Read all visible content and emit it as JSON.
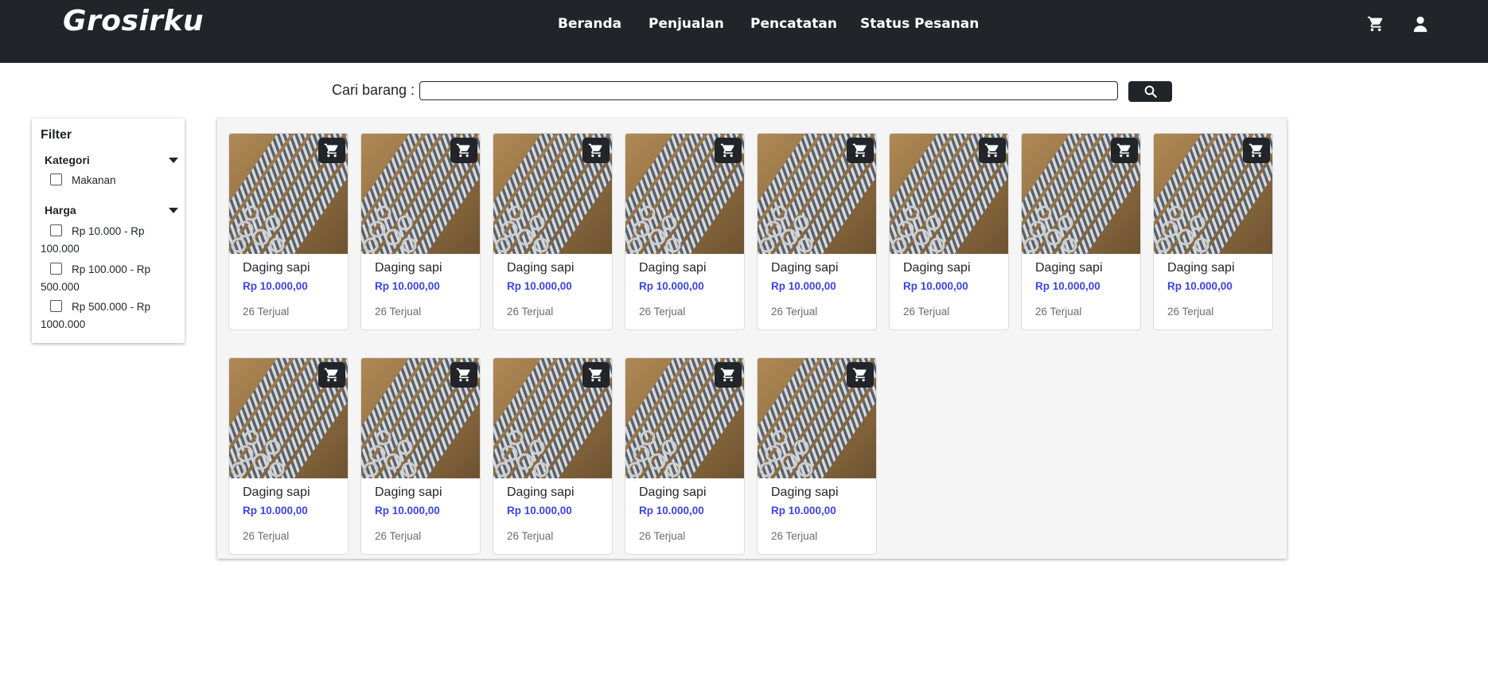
{
  "navbar": {
    "logo": "Grosirku",
    "links": [
      {
        "label": "Beranda"
      },
      {
        "label": "Penjualan"
      },
      {
        "label": "Pencatatan"
      },
      {
        "label": "Status Pesanan"
      }
    ],
    "icons": [
      "cart-icon",
      "user-icon"
    ]
  },
  "search": {
    "label": "Cari barang :",
    "value": "",
    "placeholder": "",
    "button_icon": "search-icon"
  },
  "filter": {
    "title": "Filter",
    "groups": [
      {
        "label": "Kategori",
        "options": [
          "Makanan"
        ]
      },
      {
        "label": "Harga",
        "options": [
          "Rp 10.000 - Rp 100.000",
          "Rp 100.000 - Rp 500.000",
          "Rp 500.000 - Rp 1000.000"
        ]
      }
    ]
  },
  "products": [
    {
      "name": "Daging sapi",
      "price": "Rp 10.000,00",
      "sold": "26 Terjual"
    },
    {
      "name": "Daging sapi",
      "price": "Rp 10.000,00",
      "sold": "26 Terjual"
    },
    {
      "name": "Daging sapi",
      "price": "Rp 10.000,00",
      "sold": "26 Terjual"
    },
    {
      "name": "Daging sapi",
      "price": "Rp 10.000,00",
      "sold": "26 Terjual"
    },
    {
      "name": "Daging sapi",
      "price": "Rp 10.000,00",
      "sold": "26 Terjual"
    },
    {
      "name": "Daging sapi",
      "price": "Rp 10.000,00",
      "sold": "26 Terjual"
    },
    {
      "name": "Daging sapi",
      "price": "Rp 10.000,00",
      "sold": "26 Terjual"
    },
    {
      "name": "Daging sapi",
      "price": "Rp 10.000,00",
      "sold": "26 Terjual"
    },
    {
      "name": "Daging sapi",
      "price": "Rp 10.000,00",
      "sold": "26 Terjual"
    },
    {
      "name": "Daging sapi",
      "price": "Rp 10.000,00",
      "sold": "26 Terjual"
    },
    {
      "name": "Daging sapi",
      "price": "Rp 10.000,00",
      "sold": "26 Terjual"
    },
    {
      "name": "Daging sapi",
      "price": "Rp 10.000,00",
      "sold": "26 Terjual"
    },
    {
      "name": "Daging sapi",
      "price": "Rp 10.000,00",
      "sold": "26 Terjual"
    }
  ],
  "colors": {
    "navbar": "#212529",
    "price": "#3b44e6",
    "panel": "#f5f5f5"
  }
}
